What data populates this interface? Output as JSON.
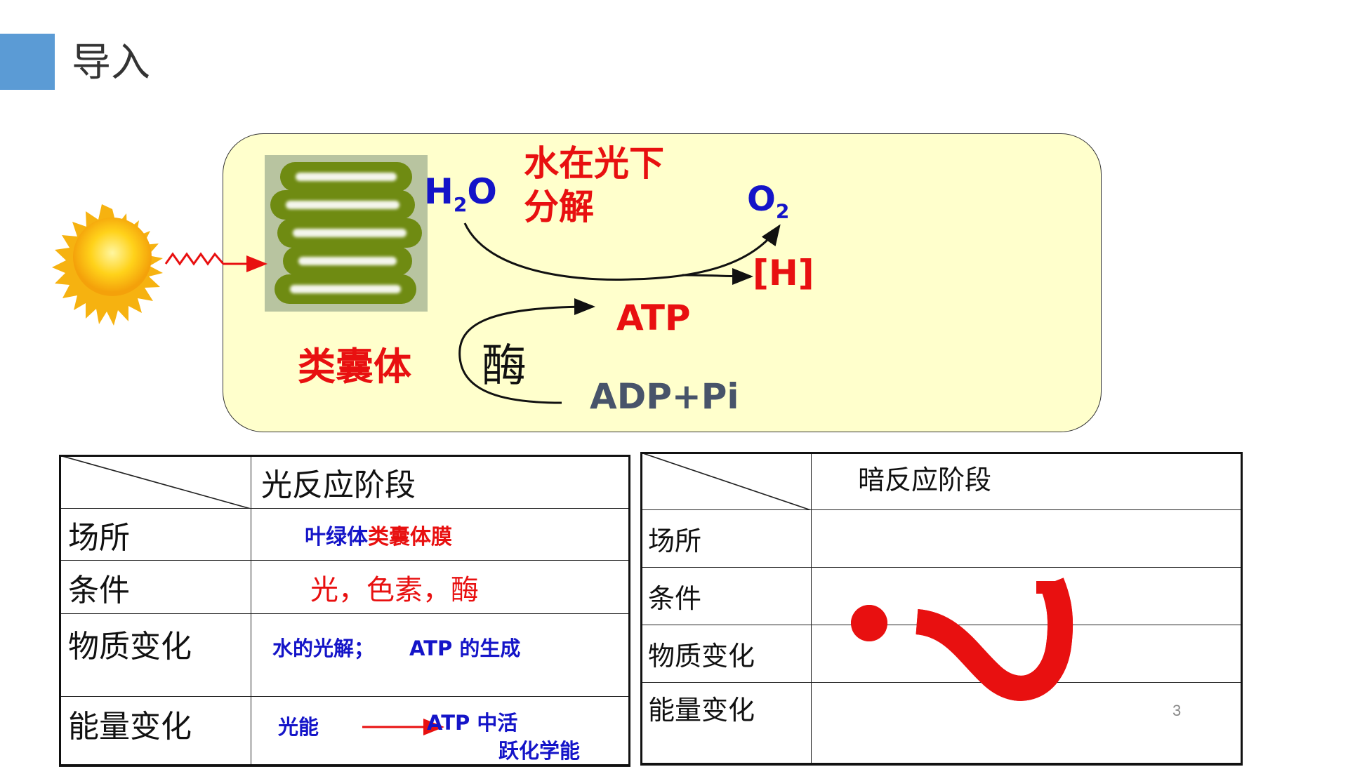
{
  "slide": {
    "title": "导入",
    "page_number": "3",
    "accent_color": "#5b9bd5"
  },
  "diagram": {
    "sun_icon": "sun-icon",
    "membrane_label": "类囊体",
    "h2o_label": "H",
    "h2o_sub": "2",
    "h2o_tail": "O",
    "photolysis_label_line1": "水在光下",
    "photolysis_label_line2": "分解",
    "o2_label": "O",
    "o2_sub": "2",
    "h_label": "[H]",
    "atp_label": "ATP",
    "enzyme_label": "酶",
    "adp_label": "ADP+Pi",
    "colors": {
      "red": "#e81010",
      "blue": "#1414c8",
      "gray": "#48546a",
      "panel": "#ffffcc"
    }
  },
  "light_table": {
    "header": "光反应阶段",
    "rows": [
      {
        "label": "场所",
        "value_part1": "叶绿体",
        "value_part2": "类囊体膜"
      },
      {
        "label": "条件",
        "value": "光，色素，酶"
      },
      {
        "label": "物质变化",
        "value_part1": "水的光解；",
        "value_part2": "ATP 的生成"
      },
      {
        "label": "能量变化",
        "value_part1": "光能",
        "value_part2": "ATP 中活",
        "value_part3": "跃化学能"
      }
    ]
  },
  "dark_table": {
    "header": "暗反应阶段",
    "rows": [
      {
        "label": "场所"
      },
      {
        "label": "条件"
      },
      {
        "label": "物质变化"
      },
      {
        "label": "能量变化"
      }
    ],
    "overlay_icon": "question-mark-icon"
  }
}
